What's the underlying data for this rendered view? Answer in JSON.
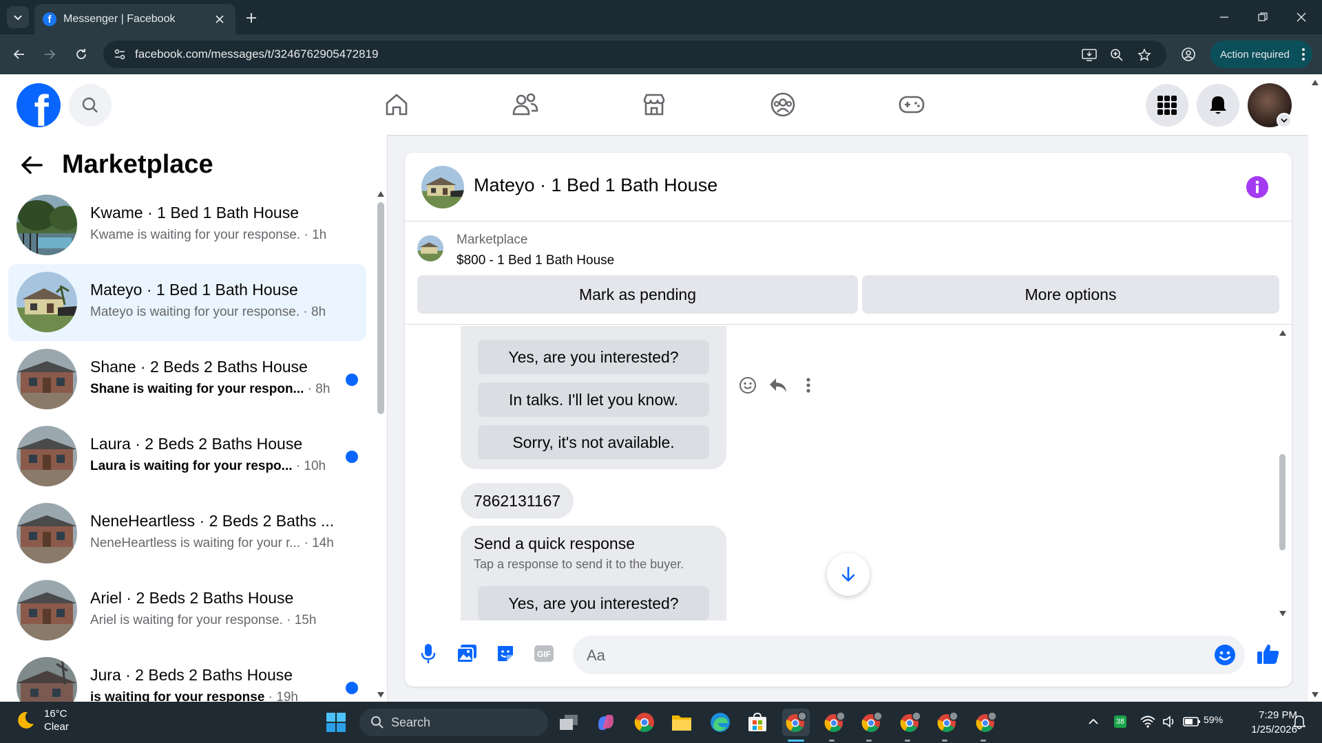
{
  "browser": {
    "tab_title": "Messenger | Facebook",
    "url": "facebook.com/messages/t/3246762905472819",
    "action_required": "Action required"
  },
  "sidebar": {
    "title": "Marketplace",
    "conversations": [
      {
        "name": "Kwame · 1 Bed 1 Bath House",
        "snippet": "Kwame is waiting for your response.",
        "time": " · 1h",
        "unread": false,
        "active": false
      },
      {
        "name": "Mateyo · 1 Bed 1 Bath House",
        "snippet": "Mateyo is waiting for your response.",
        "time": " · 8h",
        "unread": false,
        "active": true
      },
      {
        "name": "Shane · 2 Beds 2 Baths House",
        "snippet": "Shane is waiting for your respon...",
        "time": " · 8h",
        "unread": true,
        "active": false
      },
      {
        "name": "Laura · 2 Beds 2 Baths House",
        "snippet": "Laura is waiting for your respo...",
        "time": " · 10h",
        "unread": true,
        "active": false
      },
      {
        "name": "NeneHeartless · 2 Beds 2 Baths ...",
        "snippet": "NeneHeartless is waiting for your r...",
        "time": " · 14h",
        "unread": false,
        "active": false
      },
      {
        "name": "Ariel · 2 Beds 2 Baths House",
        "snippet": "Ariel is waiting for your response.",
        "time": " · 15h",
        "unread": false,
        "active": false
      },
      {
        "name": "Jura · 2 Beds 2 Baths House",
        "snippet": "is waiting for your response",
        "time": " · 19h",
        "unread": true,
        "active": false
      }
    ]
  },
  "chat": {
    "title": "Mateyo · 1 Bed 1 Bath House",
    "marketplace_label": "Marketplace",
    "listing": "$800 - 1 Bed 1 Bath House",
    "mark_pending": "Mark as pending",
    "more_options": "More options",
    "quick_replies_top": [
      "Yes, are you interested?",
      "In talks. I'll let you know.",
      "Sorry, it's not available."
    ],
    "phone_message": "7862131167",
    "quick_response_title": "Send a quick response",
    "quick_response_sub": "Tap a response to send it to the buyer.",
    "quick_replies_bottom": [
      "Yes, are you interested?"
    ],
    "composer_placeholder": "Aa"
  },
  "taskbar": {
    "weather_temp": "16°C",
    "weather_desc": "Clear",
    "search_label": "Search",
    "battery": "59%",
    "badge": "38",
    "time": "7:29 PM",
    "date": "1/25/2026"
  },
  "colors": {
    "facebook_blue": "#0866ff",
    "active_conversation": "#ebf5ff",
    "info_purple": "#a33bf2",
    "chrome_dark": "#1c2b33"
  }
}
